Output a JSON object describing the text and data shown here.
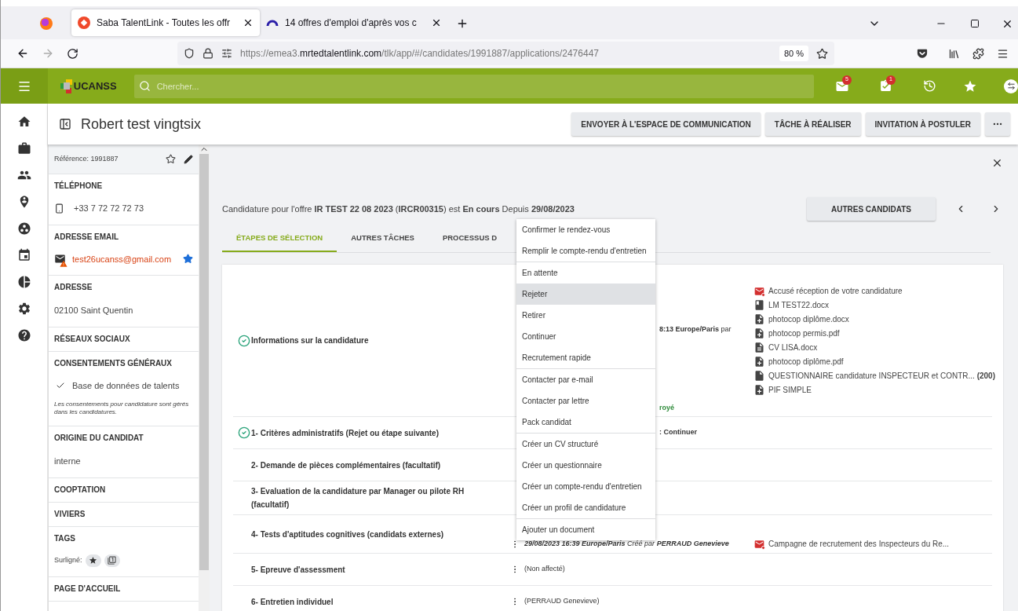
{
  "browser": {
    "tabs": [
      {
        "title": "Saba TalentLink - Toutes les offr",
        "selected": true,
        "kind": "saba"
      },
      {
        "title": "14 offres d'emploi d'après vos c",
        "selected": false,
        "kind": "arc"
      }
    ],
    "url": {
      "scheme": "https://emea3.",
      "domain": "mrtedtalentlink.com",
      "path": "/tlk/app/#/candidates/1991887/applications/2476447"
    },
    "zoom": "80 %"
  },
  "app_bar": {
    "logo": "UCANSS",
    "search_placeholder": "Chercher...",
    "mail_badge": "5",
    "task_badge": "1"
  },
  "title_bar": {
    "title": "Robert test vingtsix",
    "actions": [
      "ENVOYER À L'ESPACE DE COMMUNICATION",
      "TÂCHE À RÉALISER",
      "INVITATION À POSTULER"
    ]
  },
  "profile": {
    "reference": "Référence: 1991887",
    "sections": [
      {
        "kind": "phone",
        "title": "TÉLÉPHONE",
        "value": "+33 7 72 72 72 73"
      },
      {
        "kind": "email",
        "title": "ADRESSE EMAIL",
        "value": "test26ucanss@gmail.com",
        "favorite": true
      },
      {
        "kind": "text",
        "title": "ADRESSE",
        "value": "02100 Saint Quentin"
      },
      {
        "kind": "header",
        "title": "RÉSEAUX SOCIAUX"
      },
      {
        "kind": "consent",
        "title": "CONSENTEMENTS GÉNÉRAUX",
        "value": "Base de données de talents",
        "checked": true,
        "note": "Les consentements pour candidature sont gérés dans les candidatures."
      },
      {
        "kind": "text",
        "title": "ORIGINE DU CANDIDAT",
        "value": "interne"
      },
      {
        "kind": "header",
        "title": "COOPTATION"
      },
      {
        "kind": "header",
        "title": "VIVIERS"
      },
      {
        "kind": "tags",
        "title": "TAGS",
        "value": "Surligné:"
      },
      {
        "kind": "header",
        "title": "PAGE D'ACCUEIL"
      }
    ]
  },
  "application": {
    "summary": "Candidature pour l'offre **IR TEST 22 08 2023** (**IRCR00315**) est **En cours** Depuis **29/08/2023**",
    "other_button": "AUTRES CANDIDATS",
    "tabs": [
      {
        "label": "ÉTAPES DE SÉLECTION",
        "selected": true
      },
      {
        "label": "AUTRES TÂCHES",
        "selected": false
      },
      {
        "label": "PROCESSUS D",
        "selected": false
      }
    ],
    "steps": [
      {
        "label": "Informations sur la candidature",
        "done": true,
        "has_actions": false,
        "status": [
          {
            "kind": "time",
            "text": "**8:13 Europe/Paris** par"
          },
          {
            "kind": "result",
            "text": "royé"
          }
        ],
        "documents": [
          {
            "kind": "mail",
            "name": "Accusé réception de votre candidature"
          },
          {
            "kind": "book",
            "name": "LM TEST22.docx"
          },
          {
            "kind": "doc-plus",
            "name": "photocop diplôme.docx"
          },
          {
            "kind": "doc-plus",
            "name": "photocop permis.pdf"
          },
          {
            "kind": "doc-lines",
            "name": "CV LISA.docx"
          },
          {
            "kind": "doc-plus",
            "name": "photocop diplôme.pdf"
          },
          {
            "kind": "doc",
            "name": "QUESTIONNAIRE candidature INSPECTEUR et CONTR... **(200)**"
          },
          {
            "kind": "doc-plus",
            "name": "PIF SIMPLE"
          }
        ]
      },
      {
        "label": "1- Critères administratifs (Rejet ou étape suivante)",
        "done": true,
        "has_actions": false,
        "status": [
          {
            "kind": "decision",
            "text": ": Continuer"
          }
        ]
      },
      {
        "label": "2- Demande de pièces complémentaires (facultatif)",
        "done": false,
        "has_actions": false
      },
      {
        "label": "3- Evaluation de la candidature par Manager ou pilote RH (facultatif)",
        "done": false,
        "has_actions": false
      },
      {
        "label": "4- Tests d'aptitudes cognitives (candidats externes)",
        "done": false,
        "has_actions": true,
        "status": [
          {
            "kind": "created",
            "text": "**29/08/2023 16:39 Europe/Paris** Créé par **PERRAUD Genevieve**"
          }
        ],
        "documents": [
          {
            "kind": "mail",
            "name": "Campagne de recrutement des Inspecteurs du Re..."
          }
        ]
      },
      {
        "label": "5- Epreuve d'assessment",
        "done": false,
        "has_actions": true,
        "status": [
          {
            "kind": "assignee",
            "text": "(Non affecté)"
          }
        ]
      },
      {
        "label": "6- Entretien individuel",
        "done": false,
        "has_actions": true,
        "status": [
          {
            "kind": "assignee",
            "text": "(PERRAUD Genevieve)"
          }
        ]
      }
    ]
  },
  "context_menu": {
    "groups": [
      {
        "items": [
          {
            "label": "Confirmer le rendez-vous",
            "highlighted": false
          },
          {
            "label": "Remplir le compte-rendu d'entretien",
            "highlighted": false
          }
        ]
      },
      {
        "items": [
          {
            "label": "En attente",
            "highlighted": false
          },
          {
            "label": "Rejeter",
            "highlighted": true
          },
          {
            "label": "Retirer",
            "highlighted": false
          },
          {
            "label": "Continuer",
            "highlighted": false
          },
          {
            "label": "Recrutement rapide",
            "highlighted": false
          }
        ]
      },
      {
        "items": [
          {
            "label": "Contacter par e-mail",
            "highlighted": false
          },
          {
            "label": "Contacter par lettre",
            "highlighted": false
          },
          {
            "label": "Pack candidat",
            "highlighted": false
          }
        ]
      },
      {
        "items": [
          {
            "label": "Créer un CV structuré",
            "highlighted": false
          },
          {
            "label": "Créer un questionnaire",
            "highlighted": false
          },
          {
            "label": "Créer un compte-rendu d'entretien",
            "highlighted": false
          },
          {
            "label": "Créer un profil de candidature",
            "highlighted": false
          }
        ]
      },
      {
        "items": [
          {
            "label": "Ajouter un document",
            "highlighted": false
          }
        ]
      }
    ]
  }
}
